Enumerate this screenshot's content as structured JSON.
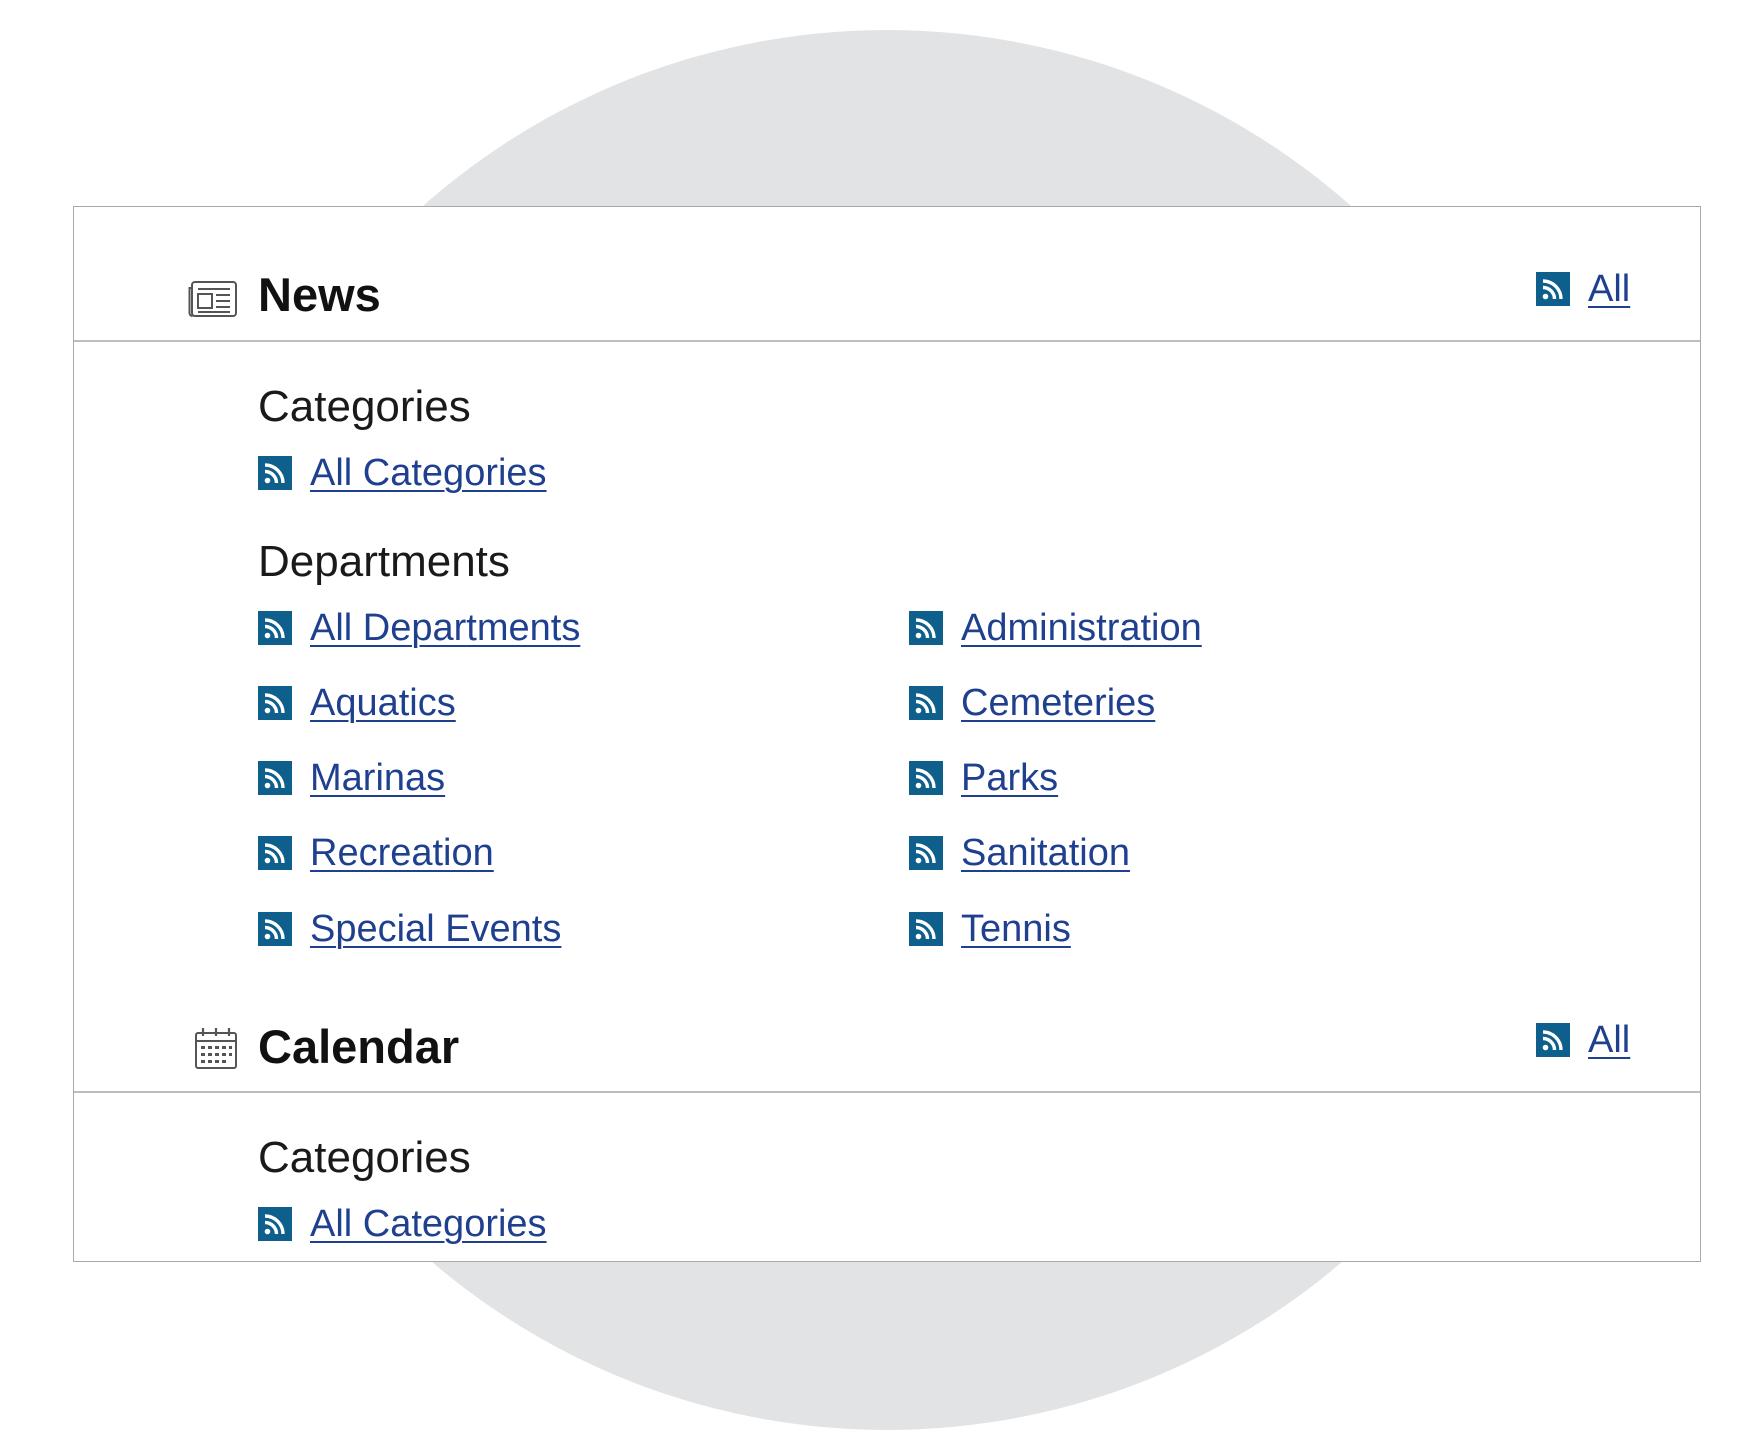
{
  "news": {
    "title": "News",
    "icon": "newspaper-icon",
    "all_label": "All",
    "categories_heading": "Categories",
    "categories": [
      "All Categories"
    ],
    "departments_heading": "Departments",
    "departments": {
      "left": [
        "All Departments",
        "Aquatics",
        "Marinas",
        "Recreation",
        "Special Events"
      ],
      "right": [
        "Administration",
        "Cemeteries",
        "Parks",
        "Sanitation",
        "Tennis"
      ]
    }
  },
  "calendar": {
    "title": "Calendar",
    "icon": "calendar-icon",
    "all_label": "All",
    "categories_heading": "Categories",
    "categories": [
      "All Categories"
    ]
  },
  "colors": {
    "rss_icon_bg": "#0f5f8c",
    "link": "#1f3f8f",
    "background_circle": "#e2e3e4",
    "divider": "#bdbdbd"
  }
}
